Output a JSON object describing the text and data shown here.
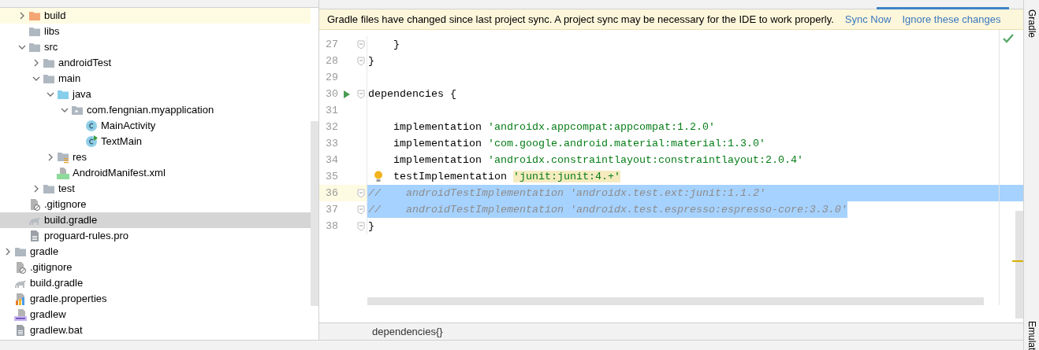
{
  "tree_app_contents": [
    {
      "label": "build",
      "kind": "excluded-folder",
      "expanded": false,
      "highlighted": true,
      "selected": false
    },
    {
      "label": "libs",
      "kind": "folder",
      "highlighted": false,
      "selected": false
    },
    {
      "label": "src",
      "kind": "folder",
      "expanded": true,
      "highlighted": false,
      "selected": false,
      "children": [
        {
          "label": "androidTest",
          "kind": "folder",
          "expanded": false,
          "highlighted": false,
          "selected": false
        },
        {
          "label": "main",
          "kind": "folder",
          "expanded": true,
          "highlighted": false,
          "selected": false,
          "children": [
            {
              "label": "java",
              "kind": "source-folder",
              "expanded": true,
              "highlighted": false,
              "selected": false,
              "children": [
                {
                  "label": "com.fengnian.myapplication",
                  "kind": "package",
                  "expanded": true,
                  "highlighted": false,
                  "selected": false,
                  "children": [
                    {
                      "label": "MainActivity",
                      "kind": "class",
                      "highlighted": false,
                      "selected": false
                    },
                    {
                      "label": "TextMain",
                      "kind": "runnable-class",
                      "highlighted": false,
                      "selected": false
                    }
                  ]
                }
              ]
            },
            {
              "label": "res",
              "kind": "resource-folder",
              "expanded": false,
              "highlighted": false,
              "selected": false
            },
            {
              "label": "AndroidManifest.xml",
              "kind": "manifest",
              "highlighted": false,
              "selected": false
            }
          ]
        },
        {
          "label": "test",
          "kind": "folder",
          "expanded": false,
          "highlighted": false,
          "selected": false
        }
      ]
    },
    {
      "label": ".gitignore",
      "kind": "ignore",
      "highlighted": false,
      "selected": false
    },
    {
      "label": "build.gradle",
      "kind": "gradle",
      "highlighted": false,
      "selected": true
    },
    {
      "label": "proguard-rules.pro",
      "kind": "text",
      "highlighted": false,
      "selected": false
    }
  ],
  "tree_project_contents": [
    {
      "label": "gradle",
      "kind": "folder",
      "expanded": false,
      "highlighted": false,
      "selected": false
    },
    {
      "label": ".gitignore",
      "kind": "ignore",
      "highlighted": false,
      "selected": false
    },
    {
      "label": "build.gradle",
      "kind": "gradle",
      "highlighted": false,
      "selected": false
    },
    {
      "label": "gradle.properties",
      "kind": "properties",
      "highlighted": false,
      "selected": false
    },
    {
      "label": "gradlew",
      "kind": "script",
      "highlighted": false,
      "selected": false
    },
    {
      "label": "gradlew.bat",
      "kind": "text",
      "highlighted": false,
      "selected": false
    }
  ],
  "notification": {
    "message": "Gradle files have changed since last project sync. A project sync may be necessary for the IDE to work properly.",
    "links": [
      "Sync Now",
      "Ignore these changes"
    ]
  },
  "code_lines": [
    {
      "number": "27",
      "fold": true,
      "run": false,
      "bulb": false,
      "current": false,
      "selected": false,
      "segments": [
        {
          "kind": "plain",
          "text": "    }"
        }
      ]
    },
    {
      "number": "28",
      "fold": true,
      "run": false,
      "bulb": false,
      "current": false,
      "selected": false,
      "segments": [
        {
          "kind": "plain",
          "text": "}"
        }
      ]
    },
    {
      "number": "29",
      "fold": false,
      "run": false,
      "bulb": false,
      "current": false,
      "selected": false
    },
    {
      "number": "30",
      "fold": true,
      "run": true,
      "bulb": false,
      "current": false,
      "selected": false,
      "segments": [
        {
          "kind": "plain",
          "text": "dependencies {"
        }
      ]
    },
    {
      "number": "31",
      "fold": false,
      "run": false,
      "bulb": false,
      "current": false,
      "selected": false
    },
    {
      "number": "32",
      "fold": false,
      "run": false,
      "bulb": false,
      "current": false,
      "selected": false,
      "segments": [
        {
          "kind": "plain",
          "text": "    implementation "
        },
        {
          "kind": "string",
          "text": "'androidx.appcompat:appcompat:1.2.0'"
        }
      ]
    },
    {
      "number": "33",
      "fold": false,
      "run": false,
      "bulb": false,
      "current": false,
      "selected": false,
      "segments": [
        {
          "kind": "plain",
          "text": "    implementation "
        },
        {
          "kind": "string",
          "text": "'com.google.android.material:material:1.3.0'"
        }
      ]
    },
    {
      "number": "34",
      "fold": false,
      "run": false,
      "bulb": false,
      "current": false,
      "selected": false,
      "segments": [
        {
          "kind": "plain",
          "text": "    implementation "
        },
        {
          "kind": "string",
          "text": "'androidx.constraintlayout:constraintlayout:2.0.4'"
        }
      ]
    },
    {
      "number": "35",
      "fold": false,
      "run": false,
      "bulb": true,
      "current": false,
      "selected": false,
      "segments": [
        {
          "kind": "plain",
          "text": "    testImplementation "
        },
        {
          "kind": "match",
          "text": "'junit:junit:4.+'"
        }
      ]
    },
    {
      "number": "36",
      "fold": true,
      "run": false,
      "bulb": false,
      "current": true,
      "selected": true,
      "segments": [
        {
          "kind": "comment",
          "text": "//    androidTestImplementation 'androidx.test.ext:junit:1.1.2'"
        }
      ]
    },
    {
      "number": "37",
      "fold": true,
      "run": false,
      "bulb": false,
      "current": false,
      "selected": true,
      "segments": [
        {
          "kind": "comment",
          "text": "//    androidTestImplementation 'androidx.test.espresso:espresso-core:3.3.0'"
        }
      ]
    },
    {
      "number": "38",
      "fold": true,
      "run": false,
      "bulb": false,
      "current": false,
      "selected": false,
      "segments": [
        {
          "kind": "plain",
          "text": "}"
        }
      ]
    }
  ],
  "breadcrumb": "dependencies{}",
  "side_tools": [
    "Gradle",
    "Emulat"
  ]
}
